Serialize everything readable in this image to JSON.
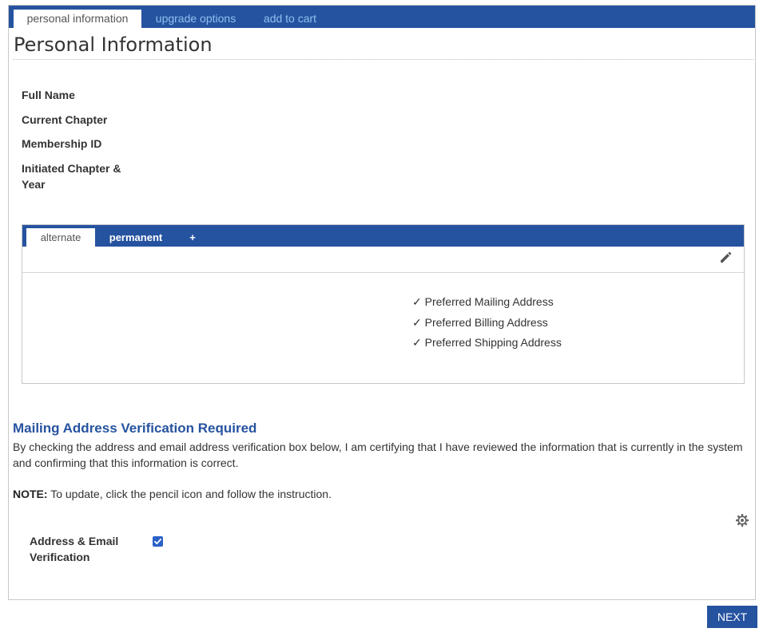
{
  "top_tabs": [
    {
      "label": "personal information",
      "active": true
    },
    {
      "label": "upgrade options",
      "active": false
    },
    {
      "label": "add to cart",
      "active": false
    }
  ],
  "page_title": "Personal Information",
  "info_fields": [
    {
      "label": "Full Name",
      "value": ""
    },
    {
      "label": "Current Chapter",
      "value": ""
    },
    {
      "label": "Membership ID",
      "value": ""
    },
    {
      "label": "Initiated Chapter & Year",
      "value": ""
    }
  ],
  "address_tabs": [
    {
      "label": "alternate",
      "active": true
    },
    {
      "label": "permanent",
      "active": false
    },
    {
      "label": "+",
      "active": false
    }
  ],
  "address_preferences": [
    "✓ Preferred Mailing Address",
    "✓ Preferred Billing Address",
    "✓ Preferred Shipping Address"
  ],
  "verification": {
    "title": "Mailing Address Verification Required",
    "text": "By checking the address and email address verification box below, I am certifying that I have reviewed the information that is currently in the system and confirming that this information is correct.",
    "note_label": "NOTE:",
    "note_text": " To update, click the pencil icon and follow the instruction.",
    "checkbox_label": "Address & Email Verification",
    "checked": true
  },
  "next_button": "NEXT",
  "colors": {
    "brand": "#2653a0",
    "inactive_tab_text": "#8fc0ee"
  },
  "icons": {
    "edit": "pencil-icon",
    "settings": "gear-icon",
    "check": "checkmark-icon"
  }
}
